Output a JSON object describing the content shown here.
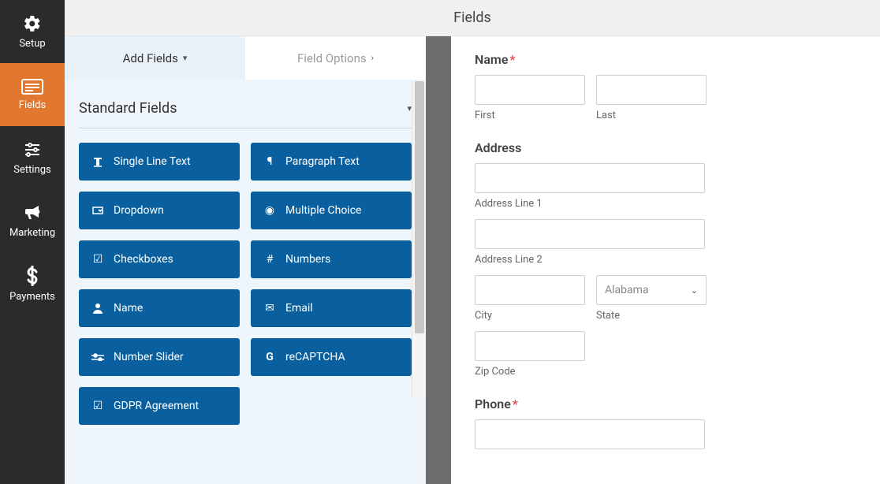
{
  "sidebar": {
    "items": [
      {
        "label": "Setup",
        "icon": "gear"
      },
      {
        "label": "Fields",
        "icon": "form"
      },
      {
        "label": "Settings",
        "icon": "sliders"
      },
      {
        "label": "Marketing",
        "icon": "bullhorn"
      },
      {
        "label": "Payments",
        "icon": "dollar"
      }
    ]
  },
  "topbar": {
    "title": "Fields"
  },
  "tabs": {
    "add": "Add Fields",
    "options": "Field Options"
  },
  "section": {
    "title": "Standard Fields"
  },
  "fields": {
    "singleLine": "Single Line Text",
    "paragraph": "Paragraph Text",
    "dropdown": "Dropdown",
    "multiple": "Multiple Choice",
    "checkboxes": "Checkboxes",
    "numbers": "Numbers",
    "name": "Name",
    "email": "Email",
    "numberSlider": "Number Slider",
    "recaptcha": "reCAPTCHA",
    "gdpr": "GDPR Agreement"
  },
  "preview": {
    "name": {
      "label": "Name",
      "first": "First",
      "last": "Last"
    },
    "address": {
      "label": "Address",
      "line1": "Address Line 1",
      "line2": "Address Line 2",
      "city": "City",
      "state": "State",
      "stateValue": "Alabama",
      "zip": "Zip Code"
    },
    "phone": {
      "label": "Phone"
    }
  }
}
